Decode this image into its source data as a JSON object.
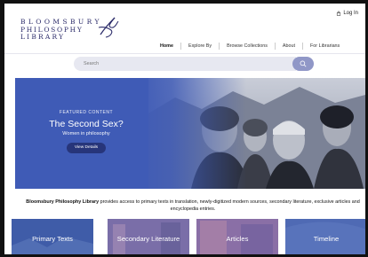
{
  "topbar": {
    "login_label": "Log In"
  },
  "logo": {
    "line1": "BLOOMSBURY",
    "line2": "PHILOSOPHY",
    "line3": "LIBRARY"
  },
  "nav": {
    "items": [
      {
        "label": "Home"
      },
      {
        "label": "Explore By"
      },
      {
        "label": "Browse Collections"
      },
      {
        "label": "About"
      },
      {
        "label": "For Librarians"
      }
    ],
    "active": "Home"
  },
  "search": {
    "placeholder": "Search"
  },
  "hero": {
    "kicker": "FEATURED CONTENT",
    "title": "The Second Sex?",
    "subtitle": "Women in philosophy",
    "button_label": "View Details"
  },
  "intro": {
    "brand": "Bloomsbury Philosophy Library",
    "text": " provides access to primary texts in translation, newly-digitized modern sources, secondary literature, exclusive articles and encyclopedia entries."
  },
  "tiles": [
    {
      "label": "Primary Texts"
    },
    {
      "label": "Secondary Literature"
    },
    {
      "label": "Articles"
    },
    {
      "label": "Timeline"
    }
  ],
  "colors": {
    "brand": "#2c2c6a",
    "hero_blue": "#3f5bb6",
    "button_navy": "#27357a",
    "search_bg": "#e7e8f1",
    "search_btn": "#9097c7"
  }
}
